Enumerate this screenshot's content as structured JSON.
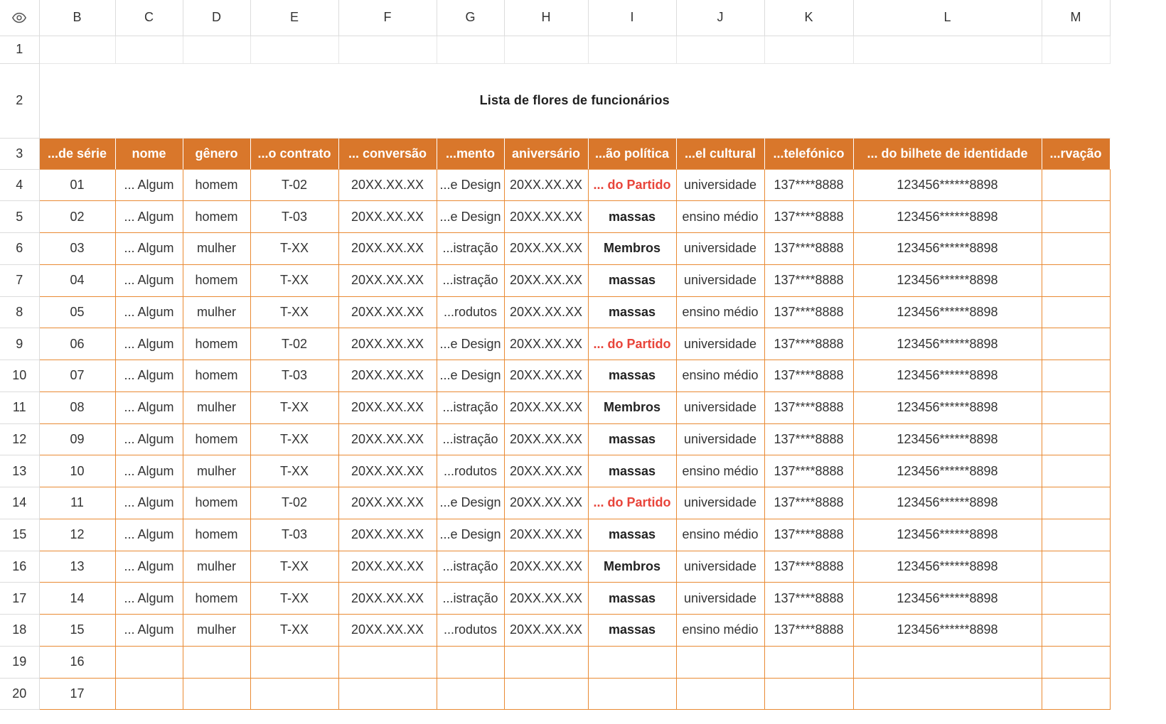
{
  "columns": [
    "B",
    "C",
    "D",
    "E",
    "F",
    "G",
    "H",
    "I",
    "J",
    "K",
    "L",
    "M"
  ],
  "row_numbers": [
    "1",
    "2",
    "3",
    "4",
    "5",
    "6",
    "7",
    "8",
    "9",
    "10",
    "11",
    "12",
    "13",
    "14",
    "15",
    "16",
    "17",
    "18",
    "19",
    "20"
  ],
  "title": "Lista de flores de funcionários",
  "headers": [
    "...de série",
    "nome",
    "gênero",
    "...o contrato",
    "... conversão",
    "...mento",
    "aniversário",
    "...ão política",
    "...el cultural",
    "...telefónico",
    "... do bilhete de identidade",
    "...rvação"
  ],
  "rows": [
    [
      "01",
      "... Algum",
      "homem",
      "T-02",
      "20XX.XX.XX",
      "...e Design",
      "20XX.XX.XX",
      "... do Partido",
      "universidade",
      "137****8888",
      "123456******8898",
      ""
    ],
    [
      "02",
      "... Algum",
      "homem",
      "T-03",
      "20XX.XX.XX",
      "...e Design",
      "20XX.XX.XX",
      "massas",
      "ensino médio",
      "137****8888",
      "123456******8898",
      ""
    ],
    [
      "03",
      "... Algum",
      "mulher",
      "T-XX",
      "20XX.XX.XX",
      "...istração",
      "20XX.XX.XX",
      "Membros",
      "universidade",
      "137****8888",
      "123456******8898",
      ""
    ],
    [
      "04",
      "... Algum",
      "homem",
      "T-XX",
      "20XX.XX.XX",
      "...istração",
      "20XX.XX.XX",
      "massas",
      "universidade",
      "137****8888",
      "123456******8898",
      ""
    ],
    [
      "05",
      "... Algum",
      "mulher",
      "T-XX",
      "20XX.XX.XX",
      "...rodutos",
      "20XX.XX.XX",
      "massas",
      "ensino médio",
      "137****8888",
      "123456******8898",
      ""
    ],
    [
      "06",
      "... Algum",
      "homem",
      "T-02",
      "20XX.XX.XX",
      "...e Design",
      "20XX.XX.XX",
      "... do Partido",
      "universidade",
      "137****8888",
      "123456******8898",
      ""
    ],
    [
      "07",
      "... Algum",
      "homem",
      "T-03",
      "20XX.XX.XX",
      "...e Design",
      "20XX.XX.XX",
      "massas",
      "ensino médio",
      "137****8888",
      "123456******8898",
      ""
    ],
    [
      "08",
      "... Algum",
      "mulher",
      "T-XX",
      "20XX.XX.XX",
      "...istração",
      "20XX.XX.XX",
      "Membros",
      "universidade",
      "137****8888",
      "123456******8898",
      ""
    ],
    [
      "09",
      "... Algum",
      "homem",
      "T-XX",
      "20XX.XX.XX",
      "...istração",
      "20XX.XX.XX",
      "massas",
      "universidade",
      "137****8888",
      "123456******8898",
      ""
    ],
    [
      "10",
      "... Algum",
      "mulher",
      "T-XX",
      "20XX.XX.XX",
      "...rodutos",
      "20XX.XX.XX",
      "massas",
      "ensino médio",
      "137****8888",
      "123456******8898",
      ""
    ],
    [
      "11",
      "... Algum",
      "homem",
      "T-02",
      "20XX.XX.XX",
      "...e Design",
      "20XX.XX.XX",
      "... do Partido",
      "universidade",
      "137****8888",
      "123456******8898",
      ""
    ],
    [
      "12",
      "... Algum",
      "homem",
      "T-03",
      "20XX.XX.XX",
      "...e Design",
      "20XX.XX.XX",
      "massas",
      "ensino médio",
      "137****8888",
      "123456******8898",
      ""
    ],
    [
      "13",
      "... Algum",
      "mulher",
      "T-XX",
      "20XX.XX.XX",
      "...istração",
      "20XX.XX.XX",
      "Membros",
      "universidade",
      "137****8888",
      "123456******8898",
      ""
    ],
    [
      "14",
      "... Algum",
      "homem",
      "T-XX",
      "20XX.XX.XX",
      "...istração",
      "20XX.XX.XX",
      "massas",
      "universidade",
      "137****8888",
      "123456******8898",
      ""
    ],
    [
      "15",
      "... Algum",
      "mulher",
      "T-XX",
      "20XX.XX.XX",
      "...rodutos",
      "20XX.XX.XX",
      "massas",
      "ensino médio",
      "137****8888",
      "123456******8898",
      ""
    ],
    [
      "16",
      "",
      "",
      "",
      "",
      "",
      "",
      "",
      "",
      "",
      "",
      ""
    ],
    [
      "17",
      "",
      "",
      "",
      "",
      "",
      "",
      "",
      "",
      "",
      "",
      ""
    ]
  ],
  "colors": {
    "header_fill": "#d9772b",
    "data_border": "#e98a33",
    "highlight_text": "#e8443a"
  },
  "icons": {
    "corner": "eye-icon"
  }
}
